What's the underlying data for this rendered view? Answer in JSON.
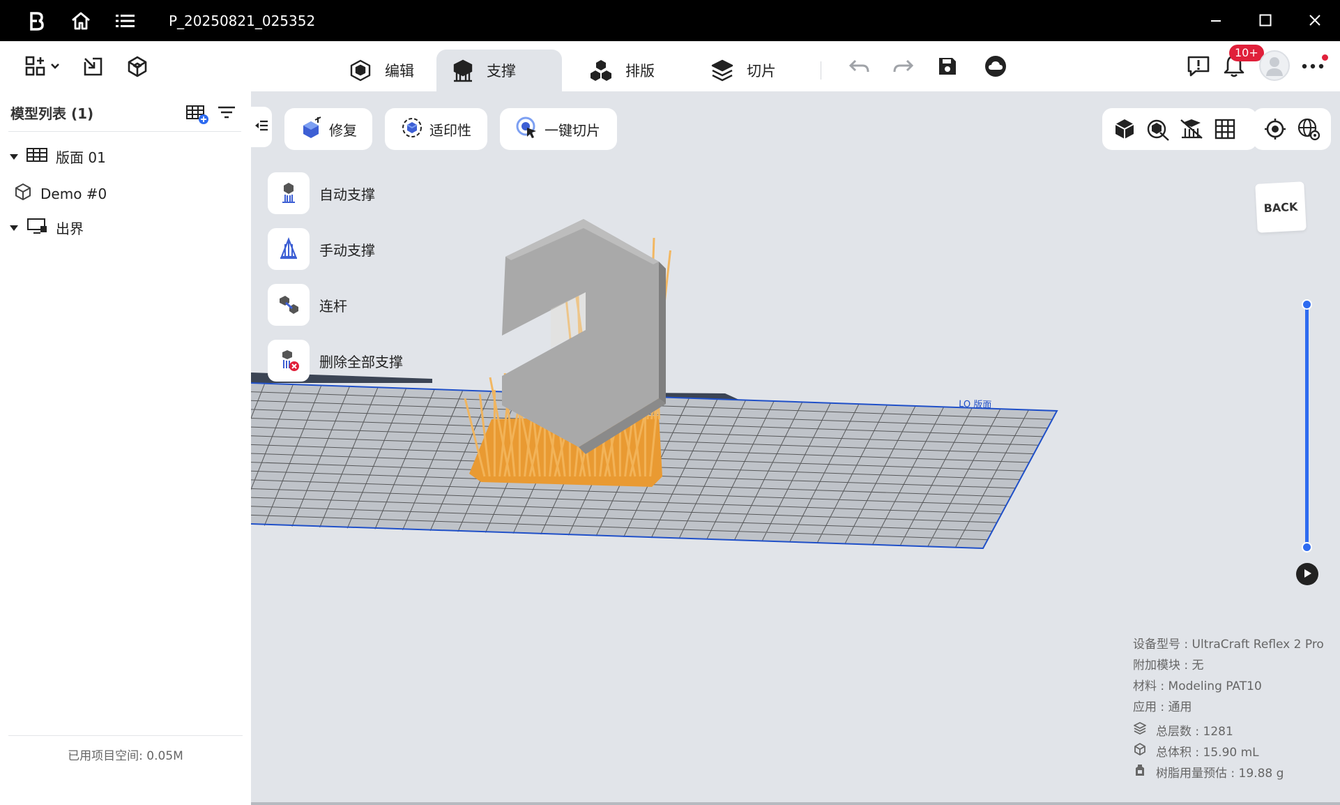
{
  "titlebar": {
    "title": "P_20250821_025352",
    "icons": [
      "app-logo-icon",
      "home-icon",
      "menu-list-icon",
      "minimize-icon",
      "maximize-icon",
      "close-icon"
    ]
  },
  "toolbar": {
    "tabs": [
      {
        "label": "编辑",
        "icon": "edit-cube-icon",
        "active": false
      },
      {
        "label": "支撑",
        "icon": "support-icon",
        "active": true
      },
      {
        "label": "排版",
        "icon": "arrange-icon",
        "active": false
      },
      {
        "label": "切片",
        "icon": "slice-layers-icon",
        "active": false
      }
    ],
    "notification_count": "10+",
    "icons": [
      "layout-grid-icon",
      "import-icon",
      "cube-icon",
      "undo-icon",
      "redo-icon",
      "save-icon",
      "cloud-icon",
      "feedback-icon",
      "bell-icon",
      "avatar",
      "more-icon"
    ]
  },
  "sidebar": {
    "title": "模型列表 (1)",
    "tree": {
      "plate": "版面 01",
      "model": "Demo #0",
      "outside": "出界"
    },
    "footer": "已用项目空间: 0.05M"
  },
  "actions": {
    "repair": "修复",
    "printability": "适印性",
    "one_click_slice": "一键切片"
  },
  "support_menu": {
    "auto": "自动支撑",
    "manual": "手动支撑",
    "link": "连杆",
    "delete_all": "删除全部支撑"
  },
  "view": {
    "back_cube_label": "BACK",
    "plate_label": "LO 版面"
  },
  "info": {
    "device": "设备型号 : UltraCraft Reflex 2 Pro",
    "module": "附加模块 : 无",
    "material": "材料 : Modeling PAT10",
    "application": "应用 : 通用",
    "layers": "总层数 : 1281",
    "volume": "总体积 : 15.90 mL",
    "resin": "树脂用量预估 : 19.88 g"
  },
  "colors": {
    "accent": "#2e6bf0",
    "support": "#f0a640",
    "model": "#a8a8a8",
    "badge": "#e0203a",
    "viewport_bg": "#e1e4e9"
  }
}
